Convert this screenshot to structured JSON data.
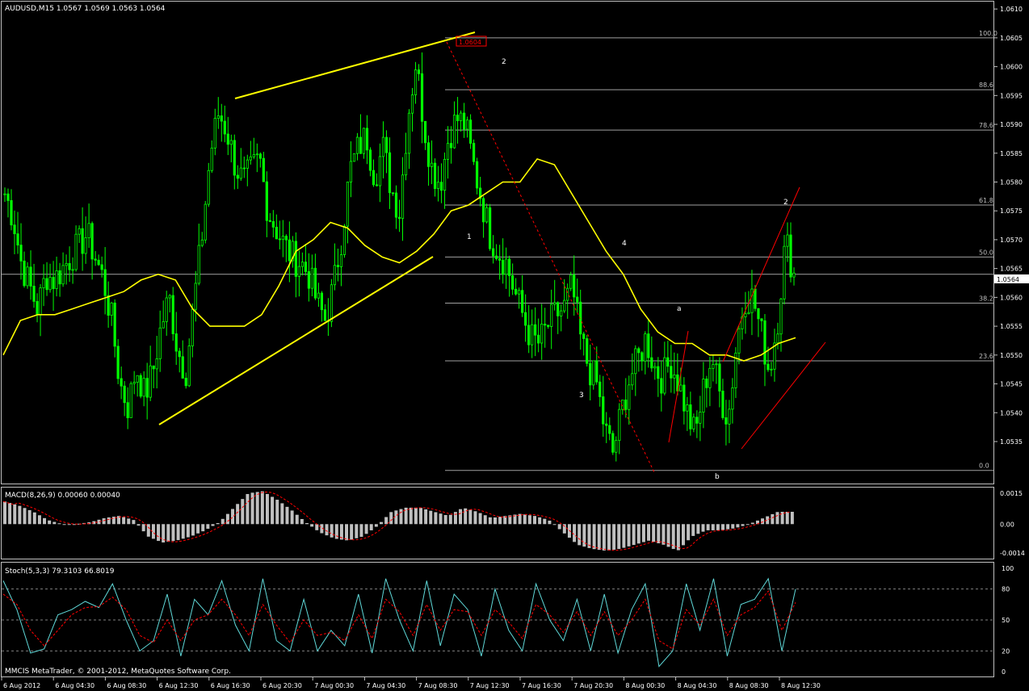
{
  "window": {
    "symbol_header": "AUDUSD,M15  1.0567 1.0569 1.0563 1.0564",
    "macd_header": "MACD(8,26,9) 0.00060 0.00040",
    "stoch_header": "Stoch(5,3,3) 79.3103 66.8019",
    "copyright": "MMCIS MetaTrader, © 2001-2012, MetaQuotes Software Corp.",
    "current_price_label": "1.0564",
    "high_label": "1.0604"
  },
  "colors": {
    "background": "#000000",
    "candle": "#00ff00",
    "ma": "#ffff00",
    "trendline": "#ffff00",
    "fib_line": "#a0a0a0",
    "wave_red": "#ff0000",
    "macd_hist": "#c0c0c0",
    "macd_signal": "#ff0000",
    "stoch_main": "#5fd8d8",
    "stoch_signal": "#ff0000",
    "grid_border": "#c0c0c0"
  },
  "chart_data": [
    {
      "type": "candlestick",
      "title": "AUDUSD,M15  1.0567 1.0569 1.0563 1.0564",
      "ylim": [
        1.0528,
        1.0611
      ],
      "y_ticks": [
        "1.0610",
        "1.0605",
        "1.0600",
        "1.0595",
        "1.0590",
        "1.0585",
        "1.0580",
        "1.0575",
        "1.0570",
        "1.0565",
        "1.0560",
        "1.0555",
        "1.0550",
        "1.0545",
        "1.0540",
        "1.0535"
      ],
      "x_ticks": [
        "6 Aug 2012",
        "6 Aug 04:30",
        "6 Aug 08:30",
        "6 Aug 12:30",
        "6 Aug 16:30",
        "6 Aug 20:30",
        "7 Aug 00:30",
        "7 Aug 04:30",
        "7 Aug 08:30",
        "7 Aug 12:30",
        "7 Aug 16:30",
        "7 Aug 20:30",
        "8 Aug 00:30",
        "8 Aug 04:30",
        "8 Aug 08:30",
        "8 Aug 12:30"
      ],
      "close_path": [
        1.0578,
        1.0574,
        1.0566,
        1.0562,
        1.0558,
        1.0564,
        1.0563,
        1.0565,
        1.0567,
        1.0569,
        1.0571,
        1.0567,
        1.0563,
        1.0556,
        1.0545,
        1.0541,
        1.0548,
        1.0543,
        1.0547,
        1.0555,
        1.056,
        1.0551,
        1.0547,
        1.0559,
        1.0571,
        1.0585,
        1.0592,
        1.0589,
        1.0583,
        1.058,
        1.0582,
        1.0584,
        1.0575,
        1.0572,
        1.0569,
        1.0567,
        1.0566,
        1.0564,
        1.0559,
        1.0556,
        1.0562,
        1.0571,
        1.0582,
        1.0586,
        1.0588,
        1.0581,
        1.0586,
        1.0579,
        1.0575,
        1.0591,
        1.0601,
        1.059,
        1.0582,
        1.058,
        1.0588,
        1.0591,
        1.059,
        1.0583,
        1.0577,
        1.0571,
        1.0568,
        1.0566,
        1.0561,
        1.0557,
        1.0553,
        1.0552,
        1.0555,
        1.0557,
        1.0558,
        1.0562,
        1.0553,
        1.0548,
        1.0545,
        1.0537,
        1.0533,
        1.054,
        1.0546,
        1.0549,
        1.0553,
        1.0548,
        1.0546,
        1.0549,
        1.0545,
        1.054,
        1.0536,
        1.0544,
        1.055,
        1.0543,
        1.0539,
        1.0552,
        1.056,
        1.056,
        1.0554,
        1.0547,
        1.0556,
        1.057,
        1.0564
      ],
      "ma_series": [
        {
          "name": "",
          "values": [
            1.055,
            1.0556,
            1.0557,
            1.0557,
            1.0558,
            1.0559,
            1.056,
            1.0561,
            1.0563,
            1.0564,
            1.0563,
            1.0558,
            1.0555,
            1.0555,
            1.0555,
            1.0557,
            1.0562,
            1.0568,
            1.057,
            1.0573,
            1.0572,
            1.0569,
            1.0567,
            1.0566,
            1.0568,
            1.0571,
            1.0575,
            1.0576,
            1.0578,
            1.058,
            1.058,
            1.0584,
            1.0583,
            1.0578,
            1.0573,
            1.0568,
            1.0564,
            1.0558,
            1.0554,
            1.0552,
            1.0552,
            1.055,
            1.055,
            1.0549,
            1.055,
            1.0552,
            1.0553
          ]
        }
      ],
      "fibonacci": [
        {
          "label": "100.0",
          "price": 1.0605
        },
        {
          "label": "88.6",
          "price": 1.0596
        },
        {
          "label": "78.6",
          "price": 1.0589
        },
        {
          "label": "61.8",
          "price": 1.0576
        },
        {
          "label": "50.0",
          "price": 1.0567
        },
        {
          "label": "38.2",
          "price": 1.0559
        },
        {
          "label": "23.6",
          "price": 1.0549
        },
        {
          "label": "0.0",
          "price": 1.053
        }
      ],
      "wave_labels": [
        "2",
        "1",
        "4",
        "3",
        "a",
        "b",
        "2"
      ]
    },
    {
      "type": "bar",
      "title": "MACD(8,26,9) 0.00060 0.00040",
      "y_ticks": [
        "0.0015",
        "0.00",
        "-0.0014"
      ],
      "ylim": [
        -0.0016,
        0.0017
      ],
      "values": [
        0.0011,
        0.0009,
        0.0006,
        0.0002,
        0.0,
        0.0,
        0.0001,
        0.0003,
        0.0004,
        0.0002,
        -0.0006,
        -0.0009,
        -0.0008,
        -0.0006,
        -0.0003,
        0.0001,
        0.0008,
        0.0015,
        0.0016,
        0.0012,
        0.0007,
        0.0001,
        -0.0004,
        -0.0007,
        -0.0008,
        -0.0006,
        -0.0001,
        0.0006,
        0.0008,
        0.0008,
        0.0006,
        0.0004,
        0.0008,
        0.0006,
        0.0003,
        0.0004,
        0.0005,
        0.0004,
        0.0002,
        -0.0004,
        -0.001,
        -0.0012,
        -0.0013,
        -0.0012,
        -0.001,
        -0.0008,
        -0.001,
        -0.0013,
        -0.0006,
        -0.0003,
        -0.0003,
        -0.0002,
        0.0,
        0.0003,
        0.0006,
        0.0006
      ]
    },
    {
      "type": "line",
      "title": "Stoch(5,3,3) 79.3103 66.8019",
      "ylim": [
        0,
        100
      ],
      "y_ticks": [
        "100",
        "80",
        "50",
        "20",
        "0"
      ],
      "series": [
        {
          "name": "",
          "values": [
            88,
            60,
            18,
            22,
            55,
            60,
            68,
            62,
            85,
            50,
            20,
            30,
            75,
            15,
            70,
            55,
            88,
            45,
            20,
            90,
            30,
            20,
            70,
            20,
            40,
            25,
            75,
            18,
            90,
            50,
            20,
            88,
            25,
            75,
            60,
            15,
            80,
            40,
            20,
            85,
            50,
            30,
            70,
            20,
            75,
            18,
            60,
            85,
            5,
            20,
            85,
            40,
            90,
            15,
            65,
            70,
            90,
            20,
            80
          ]
        },
        {
          "name": "",
          "values": [
            75,
            65,
            40,
            25,
            40,
            55,
            62,
            63,
            72,
            60,
            35,
            28,
            50,
            30,
            50,
            55,
            70,
            55,
            35,
            65,
            45,
            28,
            50,
            35,
            38,
            30,
            55,
            32,
            70,
            58,
            35,
            65,
            40,
            60,
            58,
            35,
            60,
            48,
            32,
            65,
            55,
            38,
            58,
            35,
            58,
            35,
            50,
            70,
            30,
            22,
            60,
            45,
            70,
            35,
            55,
            62,
            78,
            40,
            67
          ]
        }
      ]
    }
  ]
}
